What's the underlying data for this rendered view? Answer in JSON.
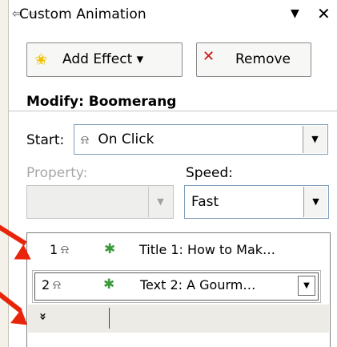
{
  "pane": {
    "title": "Custom Animation",
    "back_glyph": "⇦",
    "forward_glyph": "⇨",
    "menu_glyph": "▼",
    "close_glyph": "✕"
  },
  "toolbar": {
    "add_effect_label": "Add Effect ▾",
    "remove_label": "Remove",
    "icons": {
      "add_effect": "star-icon",
      "remove": "x-remove-icon"
    }
  },
  "modify": {
    "heading": "Modify: Boomerang"
  },
  "start": {
    "label": "Start:",
    "value": "On Click",
    "icon": "mouse-click-icon"
  },
  "property": {
    "label": "Property:",
    "value": ""
  },
  "speed": {
    "label": "Speed:",
    "value": "Fast"
  },
  "animation_list": {
    "items": [
      {
        "number": "1",
        "text": "Title 1: How to Mak…",
        "trigger_icon": "mouse-click-icon",
        "effect_icon": "animation-star-icon",
        "selected": false
      },
      {
        "number": "2",
        "text": "Text 2: A Gourm…",
        "trigger_icon": "mouse-click-icon",
        "effect_icon": "animation-star-icon",
        "selected": true
      }
    ],
    "expand_glyph": "»"
  },
  "colors": {
    "annotation_arrow": "#e8250a",
    "combo_border": "#7f9db9",
    "disabled_text": "#a7a7a7"
  }
}
